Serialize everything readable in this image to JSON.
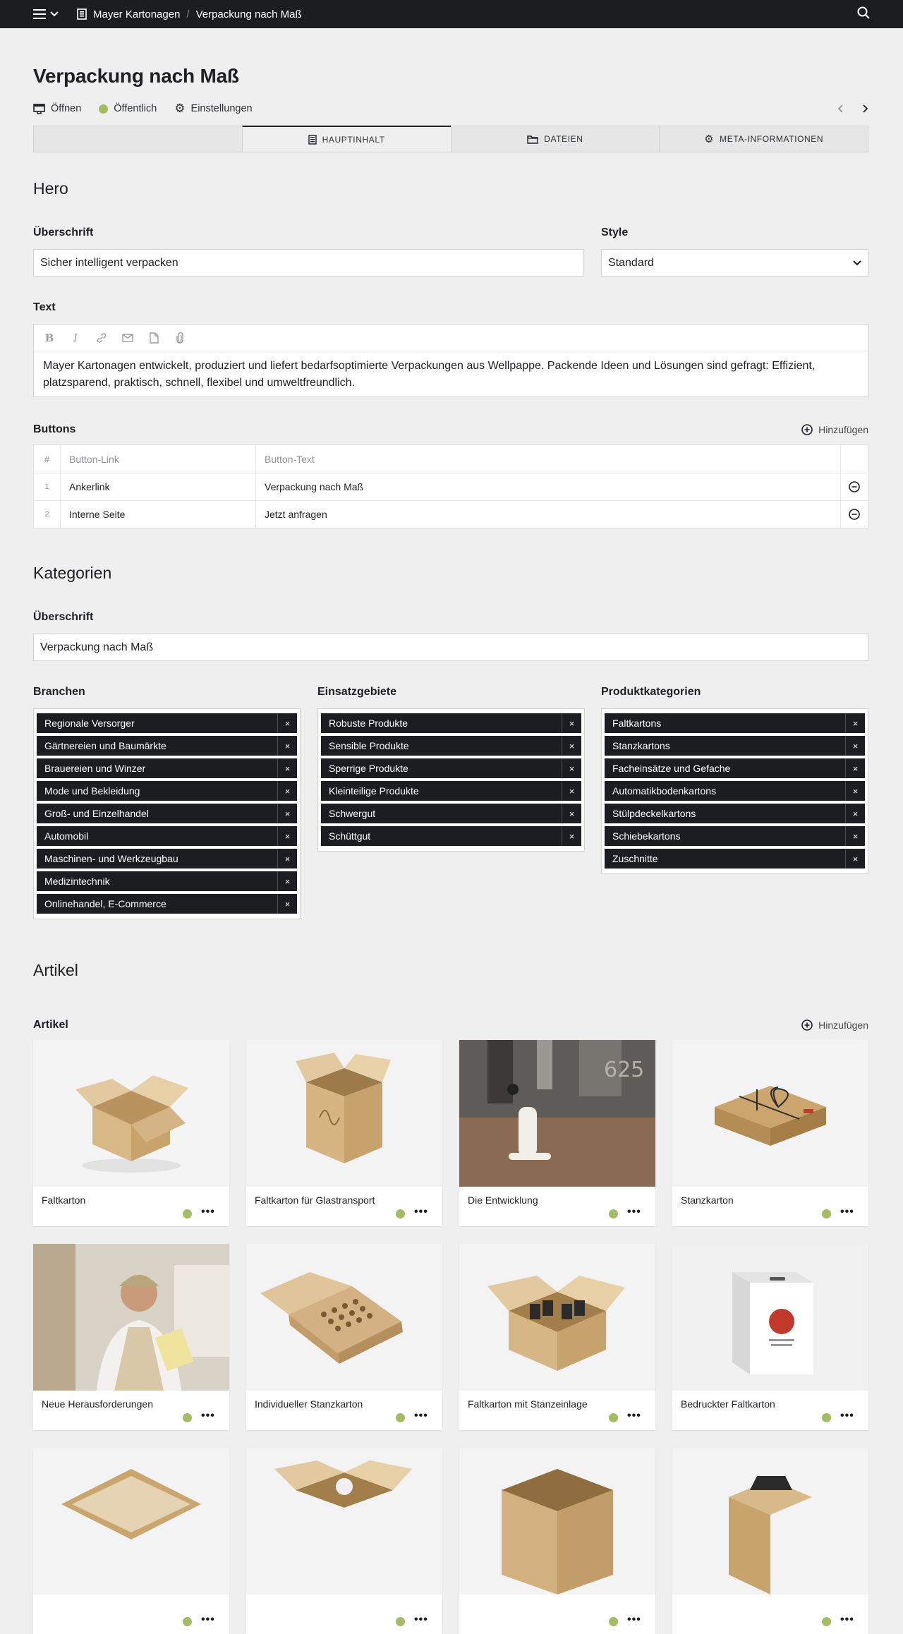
{
  "topbar": {
    "crumbs": [
      "Mayer Kartonagen",
      "Verpackung nach Maß"
    ]
  },
  "page": {
    "title": "Verpackung nach Maß",
    "actions": {
      "open": "Öffnen",
      "status": "Öffentlich",
      "settings": "Einstellungen"
    }
  },
  "tabs": [
    "",
    "HAUPTINHALT",
    "DATEIEN",
    "META-INFORMATIONEN"
  ],
  "hero": {
    "title": "Hero",
    "heading_label": "Überschrift",
    "heading_value": "Sicher intelligent verpacken",
    "style_label": "Style",
    "style_value": "Standard",
    "text_label": "Text",
    "text_value": "Mayer Kartonagen entwickelt, produziert und liefert bedarfsoptimierte Verpackungen aus Wellpappe. Packende Ideen und Lösungen sind gefragt: Effizient, platzsparend, praktisch, schnell, flexibel und umweltfreundlich.",
    "buttons_label": "Buttons",
    "add_label": "Hinzufügen",
    "table_headers": [
      "#",
      "Button-Link",
      "Button-Text"
    ],
    "table_rows": [
      {
        "num": "1",
        "link": "Ankerlink",
        "text": "Verpackung nach Maß"
      },
      {
        "num": "2",
        "link": "Interne Seite",
        "text": "Jetzt anfragen"
      }
    ]
  },
  "kategorien": {
    "title": "Kategorien",
    "heading_label": "Überschrift",
    "heading_value": "Verpackung nach Maß",
    "branchen_label": "Branchen",
    "branchen": [
      "Regionale Versorger",
      "Gärtnereien und Baumärkte",
      "Brauereien und Winzer",
      "Mode und Bekleidung",
      "Groß- und Einzelhandel",
      "Automobil",
      "Maschinen- und Werkzeugbau",
      "Medizintechnik",
      "Onlinehandel, E-Commerce"
    ],
    "einsatz_label": "Einsatzgebiete",
    "einsatz": [
      "Robuste Produkte",
      "Sensible Produkte",
      "Sperrige Produkte",
      "Kleinteilige Produkte",
      "Schwergut",
      "Schüttgut"
    ],
    "produkt_label": "Produktkategorien",
    "produkt": [
      "Faltkartons",
      "Stanzkartons",
      "Facheinsätze und Gefache",
      "Automatikbodenkartons",
      "Stülpdeckelkartons",
      "Schiebekartons",
      "Zuschnitte"
    ],
    "remove_glyph": "×"
  },
  "artikel": {
    "title": "Artikel",
    "label": "Artikel",
    "add_label": "Hinzufügen",
    "more_glyph": "•••",
    "items": [
      {
        "title": "Faltkarton",
        "image": "open-box"
      },
      {
        "title": "Faltkarton für Glastransport",
        "image": "bottle-box"
      },
      {
        "title": "Die Entwicklung",
        "image": "machine"
      },
      {
        "title": "Stanzkarton",
        "image": "gift-box"
      },
      {
        "title": "Neue Herausforderungen",
        "image": "man-phone"
      },
      {
        "title": "Individueller Stanzkarton",
        "image": "insert-box"
      },
      {
        "title": "Faltkarton mit Stanzeinlage",
        "image": "open-box-insert"
      },
      {
        "title": "Bedruckter Faltkarton",
        "image": "printed-box"
      },
      {
        "title": "",
        "image": "tray"
      },
      {
        "title": "",
        "image": "box-b"
      },
      {
        "title": "",
        "image": "box-c"
      },
      {
        "title": "",
        "image": "box-d"
      }
    ]
  },
  "colors": {
    "topbar": "#1b1d21",
    "status_green": "#a3bd62",
    "tag_bg": "#1b1d21",
    "page_bg": "#efefef"
  }
}
